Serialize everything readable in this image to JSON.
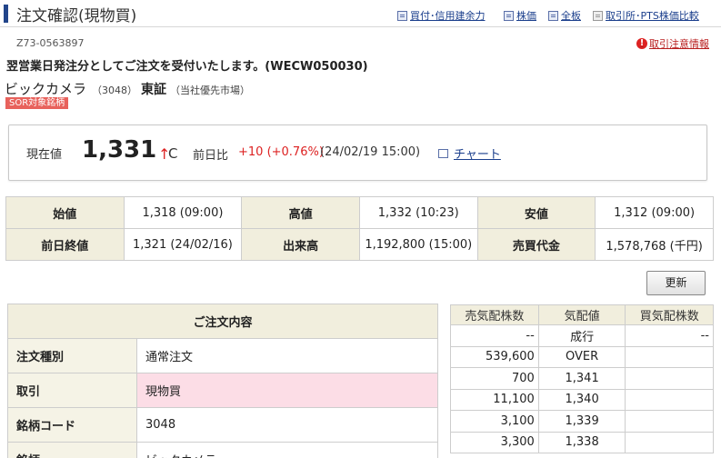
{
  "header": {
    "title": "注文確認(現物買)",
    "links": [
      {
        "label": "買付･信用建余力",
        "icon": "document-icon"
      },
      {
        "label": "株価",
        "icon": "document-icon"
      },
      {
        "label": "全板",
        "icon": "document-icon"
      },
      {
        "label": "取引所･PTS株価比較",
        "icon": "document-icon"
      }
    ]
  },
  "order_no": "Z73-0563897",
  "alert_link": "取引注意情報",
  "message": "翌営業日発注分としてご注文を受付いたします。(WECW050030)",
  "stock": {
    "name": "ビックカメラ",
    "code": "（3048）",
    "market": "東証",
    "market_note": "（当社優先市場）",
    "sor_badge": "SOR対象銘柄"
  },
  "price_box": {
    "current_label": "現在値",
    "current_price": "1,331",
    "arrow": "↑",
    "mark": "C",
    "change_label": "前日比",
    "change_value": "+10 (+0.76%)",
    "change_time": "(24/02/19 15:00)",
    "chart_link": "チャート"
  },
  "quote": {
    "rows": [
      [
        {
          "h": "始値",
          "v": "1,318 (09:00)"
        },
        {
          "h": "高値",
          "v": "1,332 (10:23)"
        },
        {
          "h": "安値",
          "v": "1,312 (09:00)"
        }
      ],
      [
        {
          "h": "前日終値",
          "v": "1,321 (24/02/16)"
        },
        {
          "h": "出来高",
          "v": "1,192,800 (15:00)"
        },
        {
          "h": "売買代金",
          "v": "1,578,768 (千円)"
        }
      ]
    ]
  },
  "refresh_label": "更新",
  "order_details": {
    "title": "ご注文内容",
    "rows": [
      {
        "key": "注文種別",
        "value": "通常注文"
      },
      {
        "key": "取引",
        "value": "現物買"
      },
      {
        "key": "銘柄コード",
        "value": "3048"
      },
      {
        "key": "銘柄",
        "value": "ビックカメラ"
      }
    ]
  },
  "board": {
    "headers": [
      "売気配株数",
      "気配値",
      "買気配株数"
    ],
    "rows": [
      {
        "sell": "--",
        "price": "成行",
        "buy": "--"
      },
      {
        "sell": "539,600",
        "price": "OVER",
        "buy": ""
      },
      {
        "sell": "700",
        "price": "1,341",
        "buy": ""
      },
      {
        "sell": "11,100",
        "price": "1,340",
        "buy": ""
      },
      {
        "sell": "3,100",
        "price": "1,339",
        "buy": ""
      },
      {
        "sell": "3,300",
        "price": "1,338",
        "buy": ""
      }
    ]
  },
  "colors": {
    "header_bar": "#22458a",
    "link": "#1a3e8c",
    "up": "#dd2222",
    "table_header_bg": "#f1eedd",
    "highlight_pink": "#fcdde6",
    "sor_badge_bg": "#e8625c"
  }
}
